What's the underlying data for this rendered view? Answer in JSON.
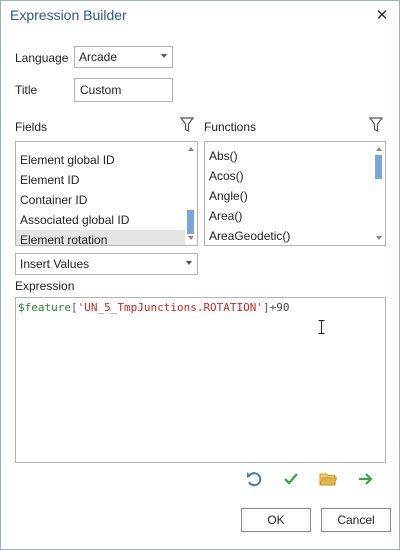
{
  "window": {
    "title": "Expression Builder",
    "close_glyph": "✕"
  },
  "language": {
    "label": "Language",
    "value": "Arcade"
  },
  "title_field": {
    "label": "Title",
    "value": "Custom"
  },
  "fields": {
    "label": "Fields",
    "items": [
      "Element global ID",
      "Element ID",
      "Container ID",
      "Associated global ID",
      "Element rotation"
    ],
    "selected_index": 4
  },
  "functions": {
    "label": "Functions",
    "items": [
      "Abs()",
      "Acos()",
      "Angle()",
      "Area()",
      "AreaGeodetic()"
    ]
  },
  "insert_values": {
    "value": "Insert Values"
  },
  "expression": {
    "label": "Expression",
    "code_var": "$feature",
    "code_open": "[",
    "code_string": "'UN_5_TmpJunctions.ROTATION'",
    "code_close": "]",
    "code_op": "+",
    "code_num": "90"
  },
  "toolbar": {
    "icons": [
      "undo-icon",
      "verify-check-icon",
      "open-folder-icon",
      "export-arrow-icon"
    ],
    "colors": {
      "undo": "#3a7fc1",
      "check": "#3aa64c",
      "folder": "#e3b64a",
      "arrow": "#3aa64c"
    }
  },
  "buttons": {
    "ok": "OK",
    "cancel": "Cancel"
  },
  "colors": {
    "title": "#2b5a87",
    "accent": "#7aa7d9",
    "selected_row": "#e5e5e5"
  }
}
